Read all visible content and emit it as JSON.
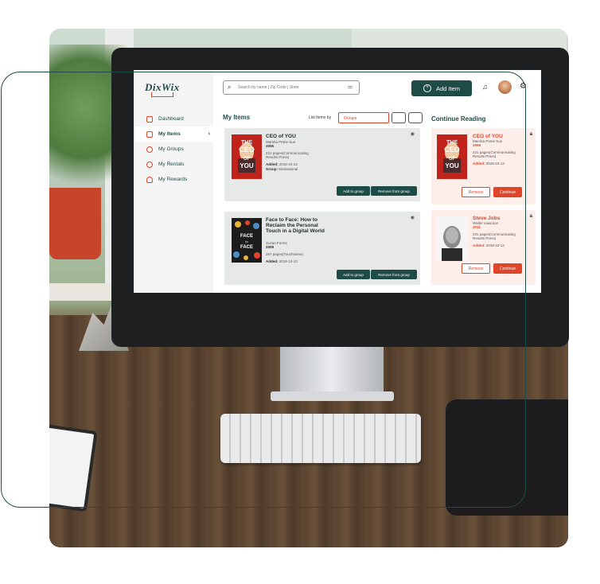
{
  "sidebar": {
    "logo": "DixWix",
    "items": [
      {
        "label": "Dashboard"
      },
      {
        "label": "My Items"
      },
      {
        "label": "My Groups"
      },
      {
        "label": "My Rentals"
      },
      {
        "label": "My Rewards"
      }
    ]
  },
  "topbar": {
    "search_placeholder": "Search by name | Zip Code | Store",
    "add_item_label": "Add Item"
  },
  "my_items": {
    "title": "My Items",
    "list_by_label": "List Items by",
    "group_select_value": "Groups",
    "items": [
      {
        "title": "CEO of YOU",
        "author": "Marsha Petrie Sue",
        "year": "2006",
        "pages": "231 pages(Communicating Results Press)",
        "added_label": "Added:",
        "added_date": "2018-10-13",
        "group_label": "Group:",
        "group_value": "Motivational",
        "add_btn": "Add to group",
        "remove_btn": "Remove from group"
      },
      {
        "title": "Face to Face: How to Reclaim the Personal Touch in a Digital World",
        "author": "Suzan Forms",
        "year": "2008",
        "pages": "267 pages(Touchstone)",
        "added_label": "Added:",
        "added_date": "2018-10-13",
        "add_btn": "Add to group",
        "remove_btn": "Remove from group"
      }
    ]
  },
  "continue_reading": {
    "title": "Continue Reading",
    "items": [
      {
        "title": "CEO of YOU",
        "author": "Marsha Petrie Sue",
        "year": "2006",
        "pages": "231 pages(Communicating Results Press)",
        "added_label": "Added:",
        "added_date": "2018-10-13",
        "remove_btn": "Remove",
        "continue_btn": "Continue",
        "store_badge": "a"
      },
      {
        "title": "Steve Jobs",
        "author": "Walter Isaacson",
        "year": "2011",
        "pages": "231 pages(Communicating Results Press)",
        "added_label": "Added:",
        "added_date": "2018-10-13",
        "remove_btn": "Remove",
        "continue_btn": "Continue",
        "store_badge": "a"
      }
    ]
  },
  "covers": {
    "ceo_line1": "THE",
    "ceo_line2": "CEO",
    "ceo_line3": "OF",
    "ceo_line4": "YOU",
    "face_line1": "FACE",
    "face_line2": "to",
    "face_line3": "FACE"
  },
  "colors": {
    "accent": "#1f4b46",
    "brand_red": "#e0442a"
  },
  "icons": [
    "search-icon",
    "filter-icon",
    "plus-circle-icon",
    "bell-icon",
    "gear-icon",
    "eye-icon",
    "chevron-right-icon"
  ]
}
